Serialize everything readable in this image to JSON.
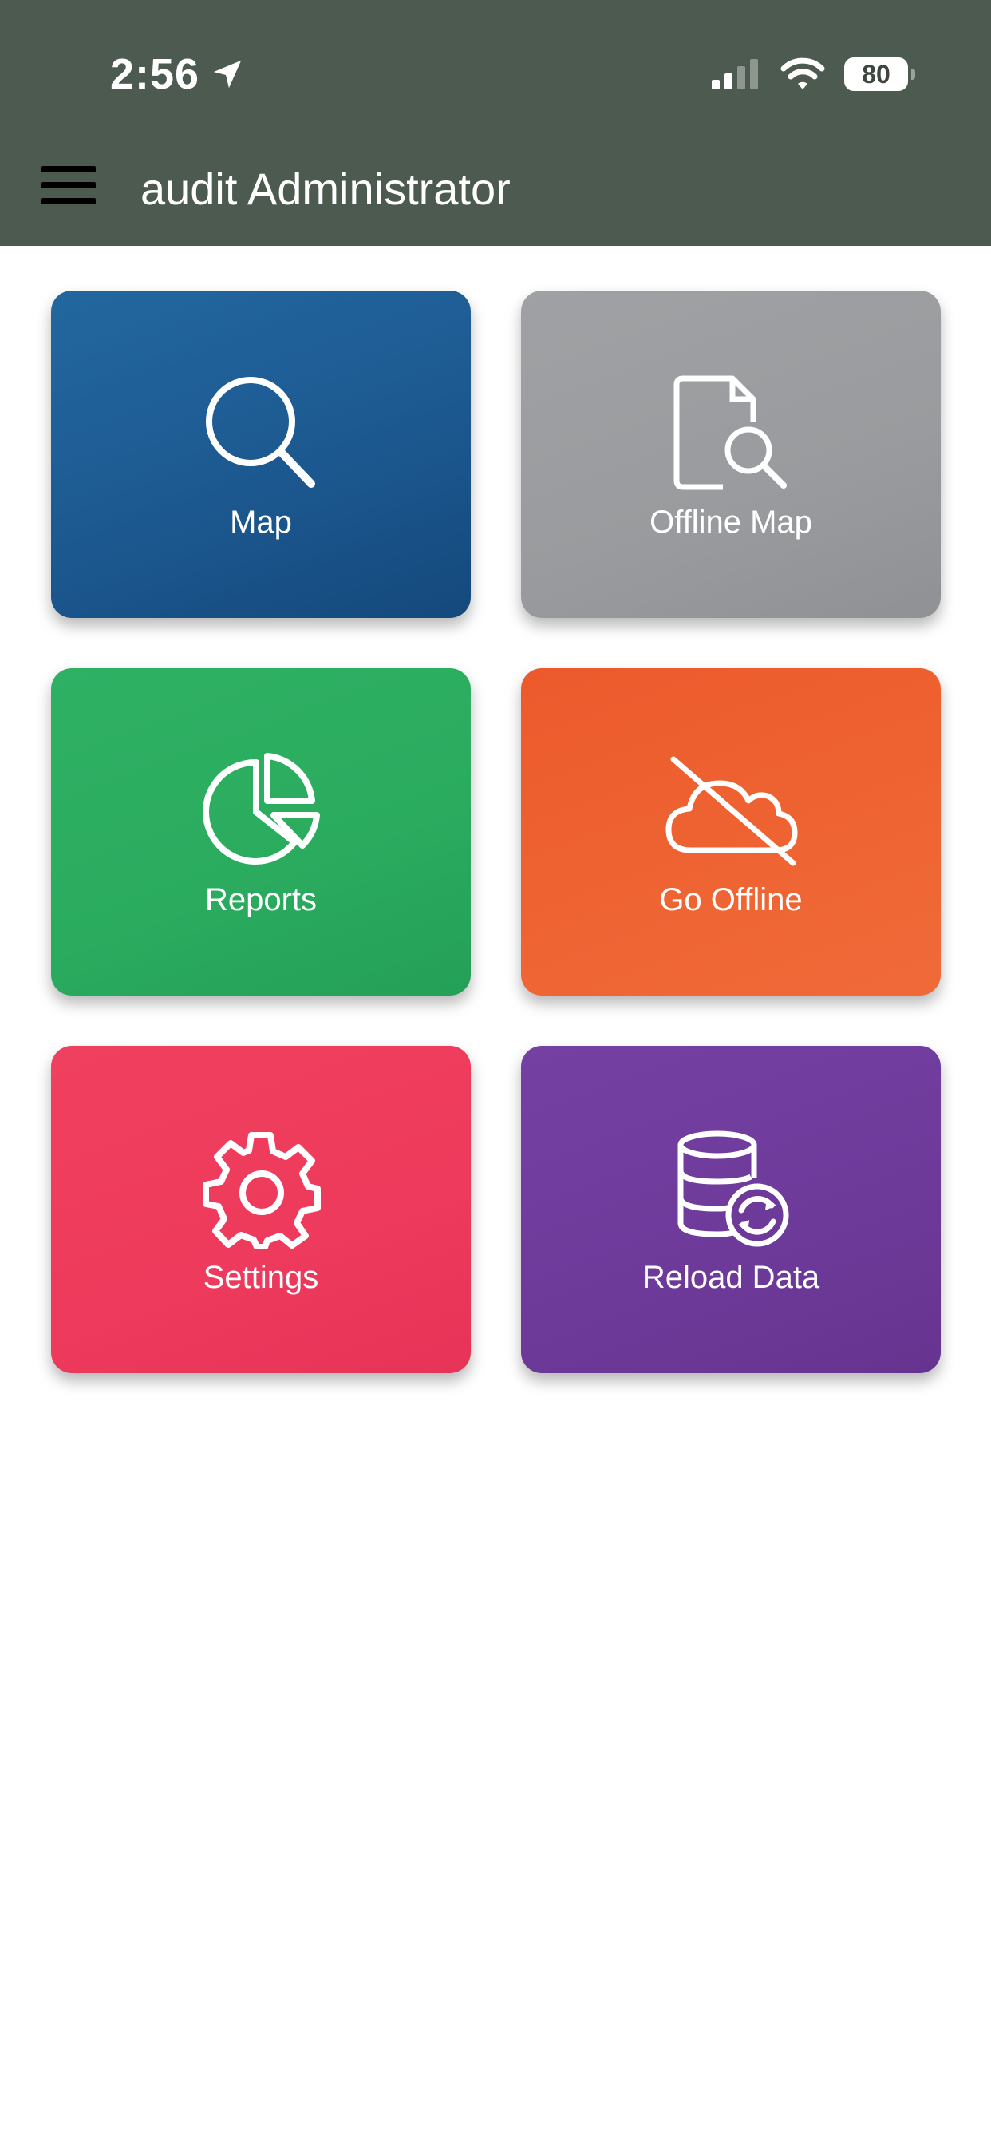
{
  "status_bar": {
    "time": "2:56",
    "battery": "80",
    "icons": [
      "location-arrow-icon",
      "signal-icon",
      "wifi-icon",
      "battery-icon"
    ]
  },
  "app_bar": {
    "title": "audit Administrator",
    "menu_icon": "hamburger-menu-icon"
  },
  "tiles": [
    {
      "label": "Map",
      "icon": "search-icon",
      "color": "#1f5f98"
    },
    {
      "label": "Offline Map",
      "icon": "document-search-icon",
      "color": "#9a9c9f"
    },
    {
      "label": "Reports",
      "icon": "pie-chart-icon",
      "color": "#2aab5e"
    },
    {
      "label": "Go Offline",
      "icon": "cloud-off-icon",
      "color": "#ef6433"
    },
    {
      "label": "Settings",
      "icon": "gear-icon",
      "color": "#ee3a5c"
    },
    {
      "label": "Reload Data",
      "icon": "database-refresh-icon",
      "color": "#6e3a9a"
    }
  ]
}
